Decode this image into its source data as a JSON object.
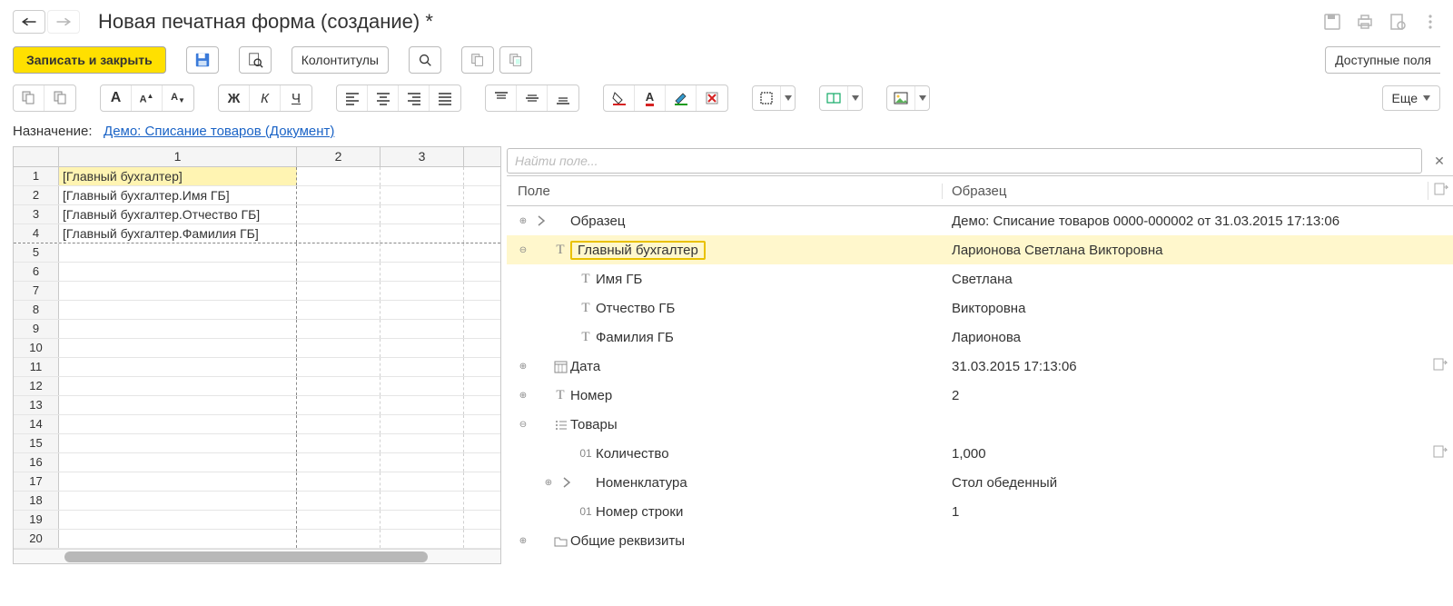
{
  "title": "Новая печатная форма (создание) *",
  "toolbar": {
    "save_close": "Записать и закрыть",
    "headers_footers": "Колонтитулы",
    "available_fields": "Доступные поля",
    "more": "Еще"
  },
  "assignment": {
    "label": "Назначение:",
    "link": "Демо: Списание товаров (Документ)"
  },
  "sheet": {
    "col_headers": [
      "1",
      "2",
      "3"
    ],
    "rows": [
      {
        "n": "1",
        "cell1": "[Главный бухгалтер]",
        "hl": true
      },
      {
        "n": "2",
        "cell1": "[Главный бухгалтер.Имя ГБ]"
      },
      {
        "n": "3",
        "cell1": "[Главный бухгалтер.Отчество ГБ]"
      },
      {
        "n": "4",
        "cell1": "[Главный бухгалтер.Фамилия ГБ]"
      },
      {
        "n": "5"
      },
      {
        "n": "6"
      },
      {
        "n": "7"
      },
      {
        "n": "8"
      },
      {
        "n": "9"
      },
      {
        "n": "10"
      },
      {
        "n": "11"
      },
      {
        "n": "12"
      },
      {
        "n": "13"
      },
      {
        "n": "14"
      },
      {
        "n": "15"
      },
      {
        "n": "16"
      },
      {
        "n": "17"
      },
      {
        "n": "18"
      },
      {
        "n": "19"
      },
      {
        "n": "20"
      }
    ]
  },
  "fields_panel": {
    "search_placeholder": "Найти поле...",
    "col_field": "Поле",
    "col_sample": "Образец",
    "rows": [
      {
        "depth": 0,
        "exp": "plus",
        "arrow": ">",
        "icon": "",
        "label": "Образец",
        "sample": "Демо: Списание товаров 0000-000002 от 31.03.2015 17:13:06"
      },
      {
        "depth": 0,
        "exp": "minus",
        "arrow": "",
        "icon": "T",
        "label": "Главный бухгалтер",
        "sample": "Ларионова Светлана Викторовна",
        "selected": true,
        "boxed": true
      },
      {
        "depth": 1,
        "exp": "",
        "arrow": "",
        "icon": "T",
        "label": "Имя ГБ",
        "sample": "Светлана"
      },
      {
        "depth": 1,
        "exp": "",
        "arrow": "",
        "icon": "T",
        "label": "Отчество ГБ",
        "sample": "Викторовна"
      },
      {
        "depth": 1,
        "exp": "",
        "arrow": "",
        "icon": "T",
        "label": "Фамилия ГБ",
        "sample": "Ларионова"
      },
      {
        "depth": 0,
        "exp": "plus",
        "arrow": "",
        "icon": "cal",
        "label": "Дата",
        "sample": "31.03.2015 17:13:06",
        "act": true
      },
      {
        "depth": 0,
        "exp": "plus",
        "arrow": "",
        "icon": "T",
        "label": "Номер",
        "sample": "2"
      },
      {
        "depth": 0,
        "exp": "minus",
        "arrow": "",
        "icon": "list",
        "label": "Товары",
        "sample": ""
      },
      {
        "depth": 1,
        "exp": "",
        "arrow": "",
        "icon": "01",
        "label": "Количество",
        "sample": "1,000",
        "act": true
      },
      {
        "depth": 1,
        "exp": "plus",
        "arrow": ">",
        "icon": "",
        "label": "Номенклатура",
        "sample": "Стол обеденный"
      },
      {
        "depth": 1,
        "exp": "",
        "arrow": "",
        "icon": "01",
        "label": "Номер строки",
        "sample": "1"
      },
      {
        "depth": 0,
        "exp": "plus",
        "arrow": "",
        "icon": "fold",
        "label": "Общие реквизиты",
        "sample": ""
      }
    ]
  }
}
